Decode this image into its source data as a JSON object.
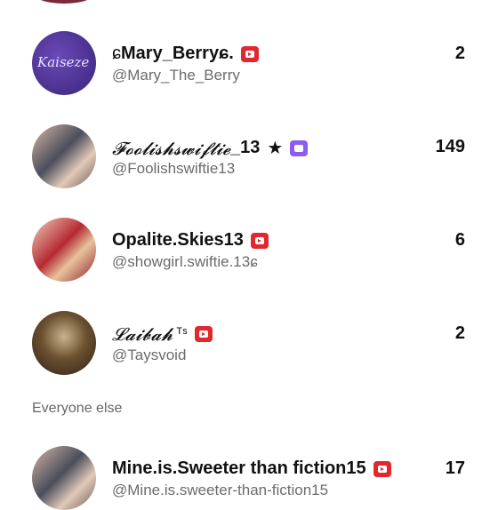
{
  "rows": [
    {
      "name_prefix": "ɕ ",
      "name": "Mary_Berry",
      "name_suffix": "ɕ.",
      "handle": "@Mary_The_Berry",
      "count": "2",
      "avatar_text": "Kaiseze"
    },
    {
      "name_prefix": "𝓕𝓸𝓸𝓵𝓲𝓼𝓱𝓼𝔀𝓲𝓯𝓽𝓲𝓮",
      "name": "_13",
      "handle": "@Foolishswiftie13",
      "count": "149"
    },
    {
      "name": "Opalite.Skies13",
      "handle": "@showgirl.swiftie.13ɕ",
      "count": "6"
    },
    {
      "name": "𝓛𝓪𝓲𝓫𝓪𝓱",
      "name_suffix": "ᵀˢ",
      "handle": "@Taysvoid",
      "count": "2"
    },
    {
      "name": "Mine.is.Sweeter than fiction15",
      "handle": "@Mine.is.sweeter-than-fiction15",
      "count": "17"
    }
  ],
  "section": {
    "everyone_else": "Everyone else"
  },
  "colors": {
    "badge_red": "#e0282e",
    "badge_purple": "#8a5cf0"
  }
}
